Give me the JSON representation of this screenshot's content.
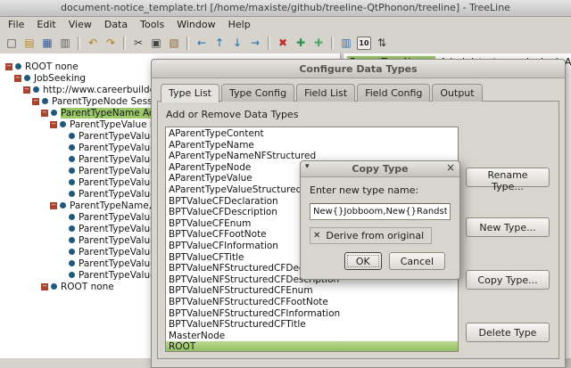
{
  "window": {
    "title": "document-notice_template.trl [/home/maxiste/github/treeline-QtPhonon/treeline] - TreeLine"
  },
  "menu": {
    "items": [
      "File",
      "Edit",
      "View",
      "Data",
      "Tools",
      "Window",
      "Help"
    ]
  },
  "toolbar": {
    "items": [
      {
        "name": "new-document-icon",
        "glyph": "□",
        "color": "#4a4a4a"
      },
      {
        "name": "open-folder-icon",
        "glyph": "▤",
        "color": "#c08a2c"
      },
      {
        "name": "save-icon",
        "glyph": "▦",
        "color": "#35589c"
      },
      {
        "name": "print-icon",
        "glyph": "▥",
        "color": "#5f5f5f"
      },
      {
        "sep": true
      },
      {
        "name": "undo-icon",
        "glyph": "↶",
        "color": "#b08020"
      },
      {
        "name": "redo-icon",
        "glyph": "↷",
        "color": "#b08020"
      },
      {
        "sep": true
      },
      {
        "name": "cut-icon",
        "glyph": "✂",
        "color": "#444444"
      },
      {
        "name": "copy-icon",
        "glyph": "▣",
        "color": "#444444"
      },
      {
        "name": "paste-icon",
        "glyph": "▧",
        "color": "#8a6a3a"
      },
      {
        "sep": true
      },
      {
        "name": "move-left-icon",
        "glyph": "←",
        "color": "#1d6fa5"
      },
      {
        "name": "move-up-icon",
        "glyph": "↑",
        "color": "#1d6fa5"
      },
      {
        "name": "move-down-icon",
        "glyph": "↓",
        "color": "#1d6fa5"
      },
      {
        "name": "move-right-icon",
        "glyph": "→",
        "color": "#1d6fa5"
      },
      {
        "sep": true
      },
      {
        "name": "delete-node-icon",
        "glyph": "✖",
        "color": "#c03028"
      },
      {
        "name": "insert-sibling-icon",
        "glyph": "✚",
        "color": "#2f8f4e"
      },
      {
        "name": "insert-child-icon",
        "glyph": "✚",
        "color": "#57a86b"
      },
      {
        "sep": true
      },
      {
        "name": "data-columns-icon",
        "glyph": "▥",
        "color": "#3a6ea5"
      },
      {
        "name": "numbering-toggle-icon",
        "glyph": "10",
        "color": "#222222",
        "small": true
      },
      {
        "name": "sort-icon",
        "glyph": "⇅",
        "color": "#333333"
      }
    ]
  },
  "tree": {
    "items": [
      {
        "label": "ROOT none",
        "level": 0,
        "expander": true,
        "selected": false
      },
      {
        "label": "JobSeeking",
        "level": 1,
        "expander": true,
        "selected": false
      },
      {
        "label": "http://www.careerbuilder.ca",
        "level": 2,
        "expander": true,
        "selected": false
      },
      {
        "label": "ParentTypeNode Session",
        "level": 3,
        "expander": true,
        "selected": false
      },
      {
        "label": "ParentTypeName Administrat",
        "level": 4,
        "expander": true,
        "selected": true
      },
      {
        "label": "ParentTypeValue none",
        "level": 5,
        "expander": true,
        "selected": false
      },
      {
        "label": "ParentTypeValue, Conten",
        "level": 6,
        "expander": false,
        "selected": false
      },
      {
        "label": "ParentTypeValue, Conten",
        "level": 6,
        "expander": false,
        "selected": false
      },
      {
        "label": "ParentTypeValue, Conten",
        "level": 6,
        "expander": false,
        "selected": false
      },
      {
        "label": "ParentTypeValue, Conten",
        "level": 6,
        "expander": false,
        "selected": false
      },
      {
        "label": "ParentTypeValue, Conten",
        "level": 6,
        "expander": false,
        "selected": false
      },
      {
        "label": "ParentTypeValue, Conten",
        "level": 6,
        "expander": false,
        "selected": false
      },
      {
        "label": "ParentTypeName, NameFie",
        "level": 5,
        "expander": true,
        "selected": false
      },
      {
        "label": "ParentTypeValue, NameFie",
        "level": 6,
        "expander": false,
        "selected": false
      },
      {
        "label": "ParentTypeValue, NameFie",
        "level": 6,
        "expander": false,
        "selected": false
      },
      {
        "label": "ParentTypeValue, NameFie",
        "level": 6,
        "expander": false,
        "selected": false
      },
      {
        "label": "ParentTypeValue, NameFie",
        "level": 6,
        "expander": false,
        "selected": false
      },
      {
        "label": "ParentTypeValue, NameFie",
        "level": 6,
        "expander": false,
        "selected": false
      },
      {
        "label": "ParentTypeValue, NameFie",
        "level": 6,
        "expander": false,
        "selected": false
      },
      {
        "label": "ROOT none",
        "level": 4,
        "expander": true,
        "selected": false
      }
    ]
  },
  "detail": {
    "field_name": "ParentTypeName",
    "field_value": "Administrateur principal, Active Directory et C"
  },
  "config_dialog": {
    "title": "Configure Data Types",
    "tabs": [
      {
        "label": "Type List",
        "active": true
      },
      {
        "label": "Type Config",
        "active": false
      },
      {
        "label": "Field List",
        "active": false
      },
      {
        "label": "Field Config",
        "active": false
      },
      {
        "label": "Output",
        "active": false
      }
    ],
    "section_label": "Add or Remove Data Types",
    "types": [
      "AParentTypeContent",
      "AParentTypeName",
      "AParentTypeNameNFStructured",
      "AParentTypeNode",
      "AParentTypeValue",
      "AParentTypeValueStructured",
      "BPTValueCFDeclaration",
      "BPTValueCFDescription",
      "BPTValueCFEnum",
      "BPTValueCFFootNote",
      "BPTValueCFInformation",
      "BPTValueCFTitle",
      "BPTValueNFStructuredCFDeclaration",
      "BPTValueNFStructuredCFDescription",
      "BPTValueNFStructuredCFEnum",
      "BPTValueNFStructuredCFFootNote",
      "BPTValueNFStructuredCFInformation",
      "BPTValueNFStructuredCFTitle",
      "MasterNode",
      "ROOT"
    ],
    "selected_type": "ROOT",
    "buttons": [
      {
        "name": "rename-type-button",
        "label": "Rename Type..."
      },
      {
        "name": "new-type-button",
        "label": "New Type..."
      },
      {
        "name": "copy-type-button",
        "label": "Copy Type..."
      },
      {
        "name": "delete-type-button",
        "label": "Delete Type"
      }
    ]
  },
  "copy_dialog": {
    "title": "Copy Type",
    "window_menu_glyph": "▾",
    "close_glyph": "×",
    "prompt": "Enter new type name:",
    "input_value": "New{}Jobboom,New{}Randstad",
    "checkbox_glyph": "✕",
    "checkbox_label": "Derive from original",
    "checkbox_checked": true,
    "buttons": {
      "ok": "OK",
      "cancel": "Cancel"
    }
  }
}
